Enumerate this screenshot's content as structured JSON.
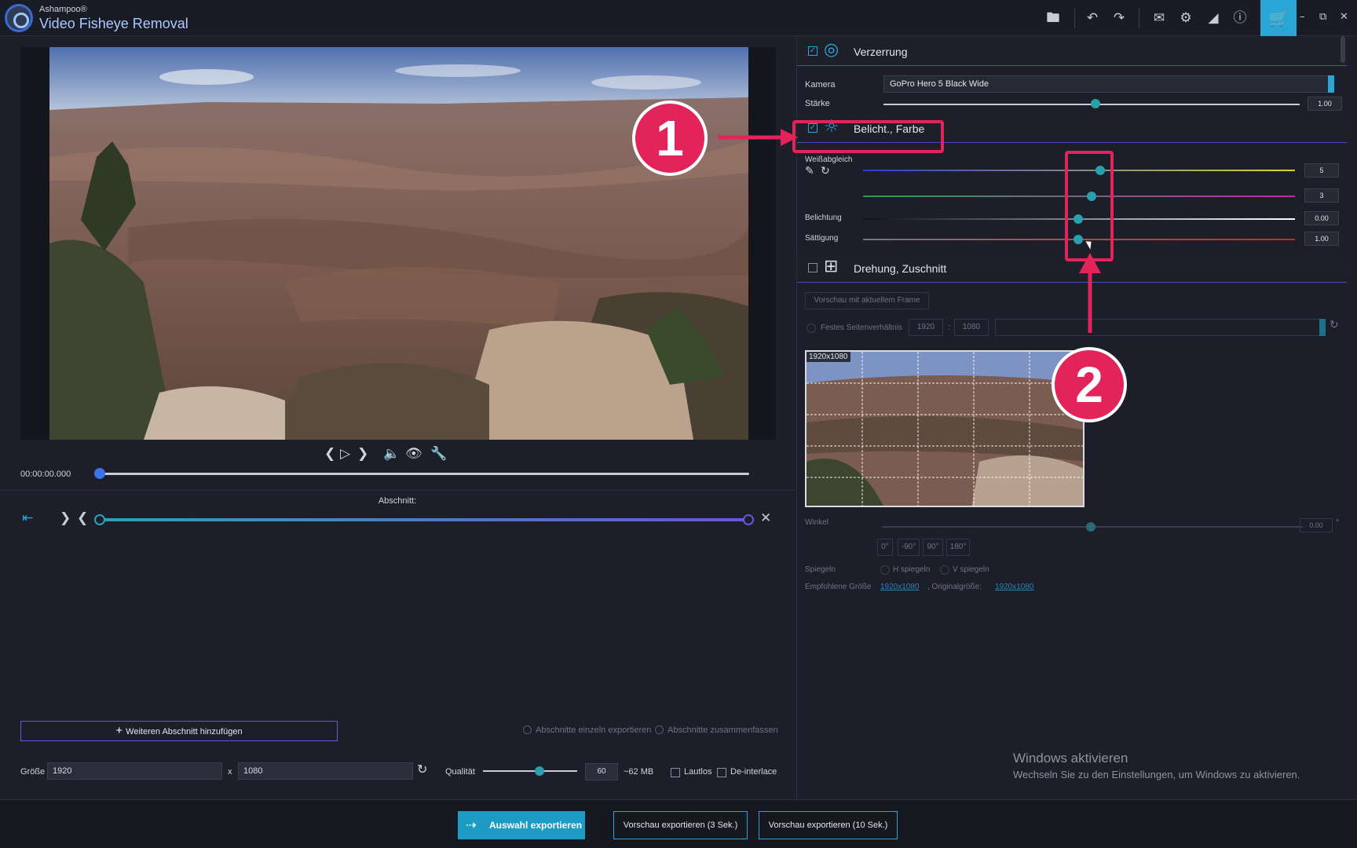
{
  "app": {
    "brand": "Ashampoo®",
    "name": "Video Fisheye Removal"
  },
  "titlebar": {
    "icons": [
      "folder-icon",
      "undo-icon",
      "redo-icon",
      "feedback-icon",
      "settings-icon",
      "theme-icon",
      "info-icon",
      "cart-icon",
      "minimize-icon",
      "restore-icon",
      "close-icon"
    ],
    "cart_color": "#2aa6d6"
  },
  "player": {
    "timecode": "00:00:00.000",
    "controls": [
      "prev-frame-icon",
      "play-icon",
      "next-frame-icon",
      "volume-icon",
      "preview-eye-icon",
      "wrench-icon"
    ]
  },
  "segment": {
    "label": "Abschnitt:"
  },
  "left_bottom": {
    "add_segment": "Weiteren Abschnitt hinzufügen",
    "export_single": "Abschnitte einzeln exportieren",
    "export_merge": "Abschnitte zusammenfassen",
    "size_label": "Größe",
    "width": "1920",
    "x": "x",
    "height": "1080",
    "quality_label": "Qualität",
    "quality_value": "60",
    "quality_fraction": 0.6,
    "estimated_size": "~62 MB",
    "mute_label": "Lautlos",
    "deinterlace_label": "De-interlace"
  },
  "distortion": {
    "title": "Verzerrung",
    "enabled": true,
    "camera_label": "Kamera",
    "camera_value": "GoPro Hero 5 Black Wide",
    "strength_label": "Stärke",
    "strength_value": "1.00"
  },
  "exposure": {
    "title": "Belicht., Farbe",
    "enabled": true,
    "wb_label": "Weißabgleich",
    "wb_value1": "5",
    "wb_value2": "3",
    "exposure_label": "Belichtung",
    "exposure_value": "0.00",
    "saturation_label": "Sättigung",
    "saturation_value": "1.00"
  },
  "rotation": {
    "title": "Drehung, Zuschnitt",
    "enabled": false,
    "preview_btn": "Vorschau mit aktuellem Frame",
    "fixed_ratio_label": "Festes Seitenverhältnis",
    "ratio_w": "1920",
    "ratio_sep": ":",
    "ratio_h": "1080",
    "thumb_res": "1920x1080",
    "angle_label": "Winkel",
    "angle_value": "0.00",
    "degree_symbol": "°",
    "angle_presets": [
      "0°",
      "-90°",
      "90°",
      "180°"
    ],
    "mirror_label": "Spiegeln",
    "mirror_h": "H spiegeln",
    "mirror_v": "V spiegeln",
    "recommended_label": "Empfohlene Größe",
    "recommended_value": "1920x1080",
    "original_label": ", Originalgröße:",
    "original_value": "1920x1080"
  },
  "watermark": {
    "line1": "Windows aktivieren",
    "line2": "Wechseln Sie zu den Einstellungen, um Windows zu aktivieren."
  },
  "bottom": {
    "export": "Auswahl exportieren",
    "preview3": "Vorschau exportieren (3 Sek.)",
    "preview10": "Vorschau exportieren (10 Sek.)"
  },
  "annotations": {
    "one": "1",
    "two": "2",
    "color": "#e2245a"
  }
}
